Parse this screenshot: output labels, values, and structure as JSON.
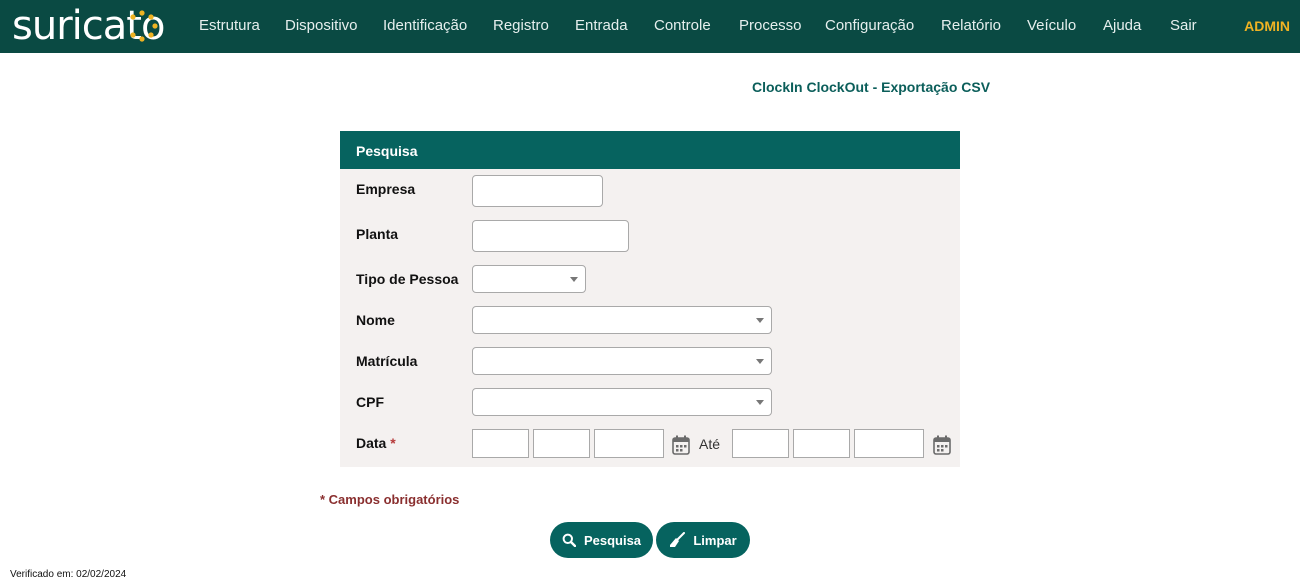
{
  "header": {
    "logo_text": "suricato",
    "nav": [
      "Estrutura",
      "Dispositivo",
      "Identificação",
      "Registro",
      "Entrada",
      "Controle",
      "Processo",
      "Configuração",
      "Relatório",
      "Veículo",
      "Ajuda",
      "Sair"
    ],
    "user": "ADMIN"
  },
  "page": {
    "title": "ClockIn ClockOut - Exportação CSV"
  },
  "form": {
    "header": "Pesquisa",
    "fields": {
      "empresa": {
        "label": "Empresa",
        "value": ""
      },
      "planta": {
        "label": "Planta",
        "value": ""
      },
      "tipo_pessoa": {
        "label": "Tipo de Pessoa",
        "value": ""
      },
      "nome": {
        "label": "Nome",
        "value": ""
      },
      "matricula": {
        "label": "Matrícula",
        "value": ""
      },
      "cpf": {
        "label": "CPF",
        "value": ""
      },
      "data": {
        "label": "Data",
        "required_mark": "*",
        "between": "Até"
      }
    }
  },
  "required_note": "* Campos obrigatórios",
  "buttons": {
    "search": "Pesquisa",
    "clear": "Limpar"
  },
  "footer": {
    "verified": "Verificado em: 02/02/2024"
  },
  "colors": {
    "header_bg": "#0a4a43",
    "accent": "#06635f",
    "admin": "#f0b323",
    "panel_bg": "#f4f1f0"
  },
  "icons": {
    "search": "search-icon",
    "clear": "broom-icon",
    "calendar": "calendar-icon"
  }
}
